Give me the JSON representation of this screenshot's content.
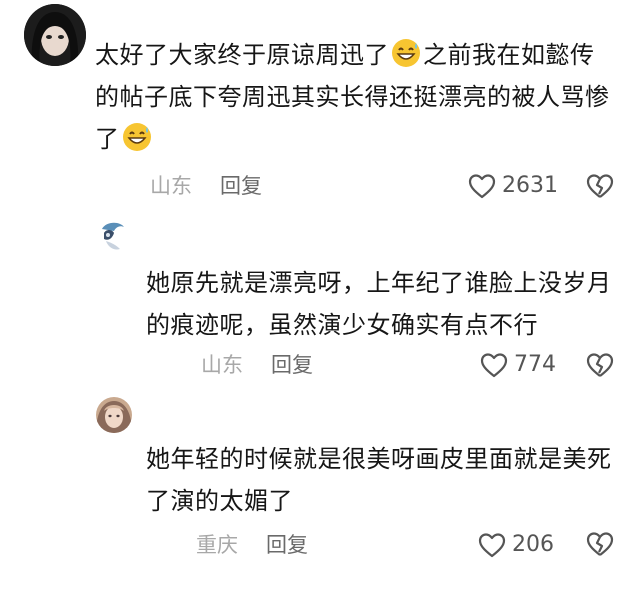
{
  "comments": [
    {
      "text_part1": "太好了大家终于原谅周迅了",
      "text_part2": "之前我在如懿传的帖子底下夸周迅其实长得还挺漂亮的被人骂惨了",
      "emoji": "grinning-sweat-emoji",
      "location": "山东",
      "reply_label": "回复",
      "likes": "2631"
    },
    {
      "text": "她原先就是漂亮呀，上年纪了谁脸上没岁月的痕迹呢，虽然演少女确实有点不行",
      "location": "山东",
      "reply_label": "回复",
      "likes": "774"
    },
    {
      "text": "她年轻的时候就是很美呀画皮里面就是美死了演的太媚了",
      "location": "重庆",
      "reply_label": "回复",
      "likes": "206"
    }
  ],
  "colors": {
    "text": "#161616",
    "meta": "#8a8a8a",
    "icon": "#555555"
  }
}
